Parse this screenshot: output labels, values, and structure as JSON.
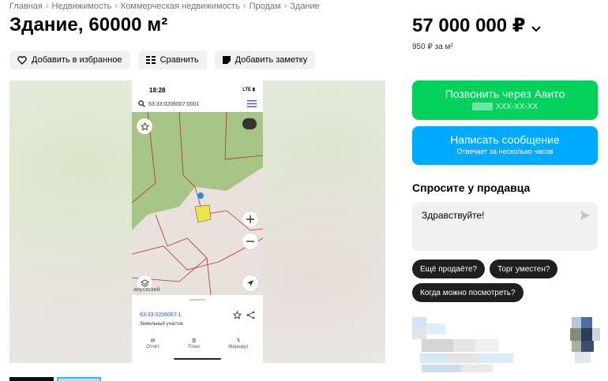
{
  "breadcrumb": [
    "Главная",
    "Недвижимость",
    "Коммерческая недвижимость",
    "Продам",
    "Здание"
  ],
  "title": "Здание, 60000 м²",
  "price": {
    "value": "57 000 000 ₽",
    "per_m2": "950 ₽ за м²"
  },
  "actions": {
    "favorite": "Добавить в избранное",
    "compare": "Сравнить",
    "note": "Добавить заметку"
  },
  "phone_screenshot": {
    "time": "18:28",
    "network": "LTE",
    "search_value": "63:33:0206007:0001",
    "cadastral": "63:33:0206007:1",
    "land_type": "Земельный участок",
    "tabs": [
      "Отчёт",
      "План",
      "Маршрут"
    ],
    "map_place": "анровский"
  },
  "contact": {
    "call_label": "Позвонить через Авито",
    "call_phone": "XXX-XX-XX",
    "message_label": "Написать сообщение",
    "message_sub": "Отвечает за несколько часов"
  },
  "ask": {
    "title": "Спросите у продавца",
    "input_value": "Здравствуйте!",
    "chips": [
      "Ещё продаёте?",
      "Торг уместен?",
      "Когда можно посмотреть?"
    ]
  },
  "colors": {
    "call": "#02d15c",
    "message": "#00aaff",
    "chip": "#1f1f1f"
  }
}
